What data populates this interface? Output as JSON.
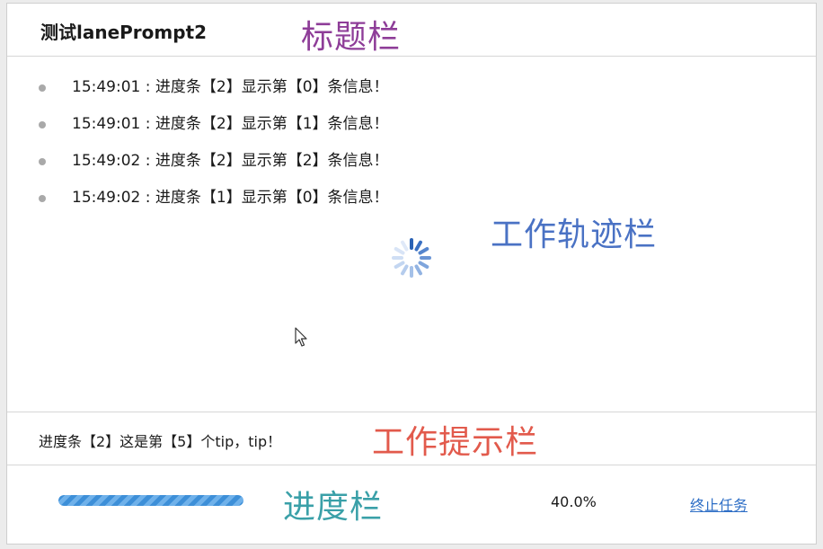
{
  "titlebar": {
    "title": "测试lanePrompt2"
  },
  "annotations": {
    "title_bar": "标题栏",
    "track_bar": "工作轨迹栏",
    "tip_bar": "工作提示栏",
    "progress_bar": "进度栏"
  },
  "track": {
    "items": [
      {
        "text": "15:49:01 : 进度条【2】显示第【0】条信息！"
      },
      {
        "text": "15:49:01 : 进度条【2】显示第【1】条信息！"
      },
      {
        "text": "15:49:02 : 进度条【2】显示第【2】条信息！"
      },
      {
        "text": "15:49:02 : 进度条【1】显示第【0】条信息！"
      }
    ]
  },
  "tip": {
    "text": "进度条【2】这是第【5】个tip，tip！"
  },
  "progress": {
    "value_fraction": 0.4,
    "percent_label": "40.0%",
    "stop_label": "终止任务"
  },
  "colors": {
    "annotation_title": "#8e3d98",
    "annotation_track": "#4a72c4",
    "annotation_tip": "#e25a4c",
    "annotation_progress": "#3aa0a8",
    "progress_fill": "#3d8fd8",
    "link": "#2f6fc6"
  },
  "icons": {
    "spinner": "loading-spinner-icon",
    "cursor": "mouse-cursor-icon"
  }
}
